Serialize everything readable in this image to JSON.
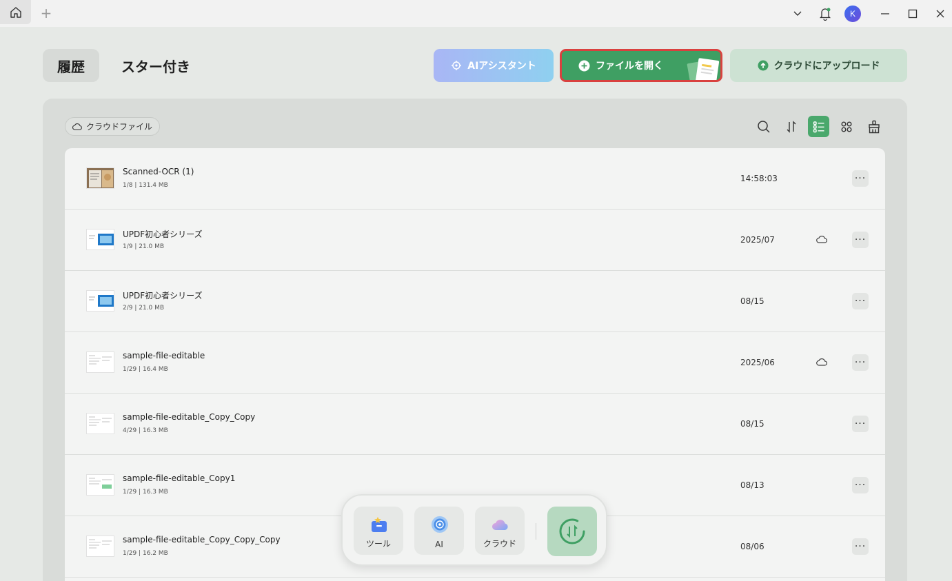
{
  "titlebar": {
    "avatar_letter": "K"
  },
  "header": {
    "tab_history": "履歴",
    "tab_starred": "スター付き",
    "ai_button": "AIアシスタント",
    "open_button": "ファイルを開く",
    "upload_button": "クラウドにアップロード"
  },
  "toolbar": {
    "cloud_chip": "クラウドファイル"
  },
  "files": [
    {
      "name": "Scanned-OCR (1)",
      "meta": "1/8 | 131.4 MB",
      "date": "14:58:03",
      "cloud": false
    },
    {
      "name": "UPDF初心者シリーズ",
      "meta": "1/9 | 21.0 MB",
      "date": "2025/07",
      "cloud": true
    },
    {
      "name": "UPDF初心者シリーズ",
      "meta": "2/9 | 21.0 MB",
      "date": "08/15",
      "cloud": false
    },
    {
      "name": "sample-file-editable",
      "meta": "1/29 | 16.4 MB",
      "date": "2025/06",
      "cloud": true
    },
    {
      "name": "sample-file-editable_Copy_Copy",
      "meta": "4/29 | 16.3 MB",
      "date": "08/15",
      "cloud": false
    },
    {
      "name": "sample-file-editable_Copy1",
      "meta": "1/29 | 16.3 MB",
      "date": "08/13",
      "cloud": false
    },
    {
      "name": "sample-file-editable_Copy_Copy_Copy",
      "meta": "1/29 | 16.2 MB",
      "date": "08/06",
      "cloud": false
    }
  ],
  "more_label": "···",
  "dock": {
    "tools": "ツール",
    "ai": "AI",
    "cloud": "クラウド"
  },
  "colors": {
    "accent_green": "#3f9f63",
    "highlight_red": "#d9413f"
  }
}
